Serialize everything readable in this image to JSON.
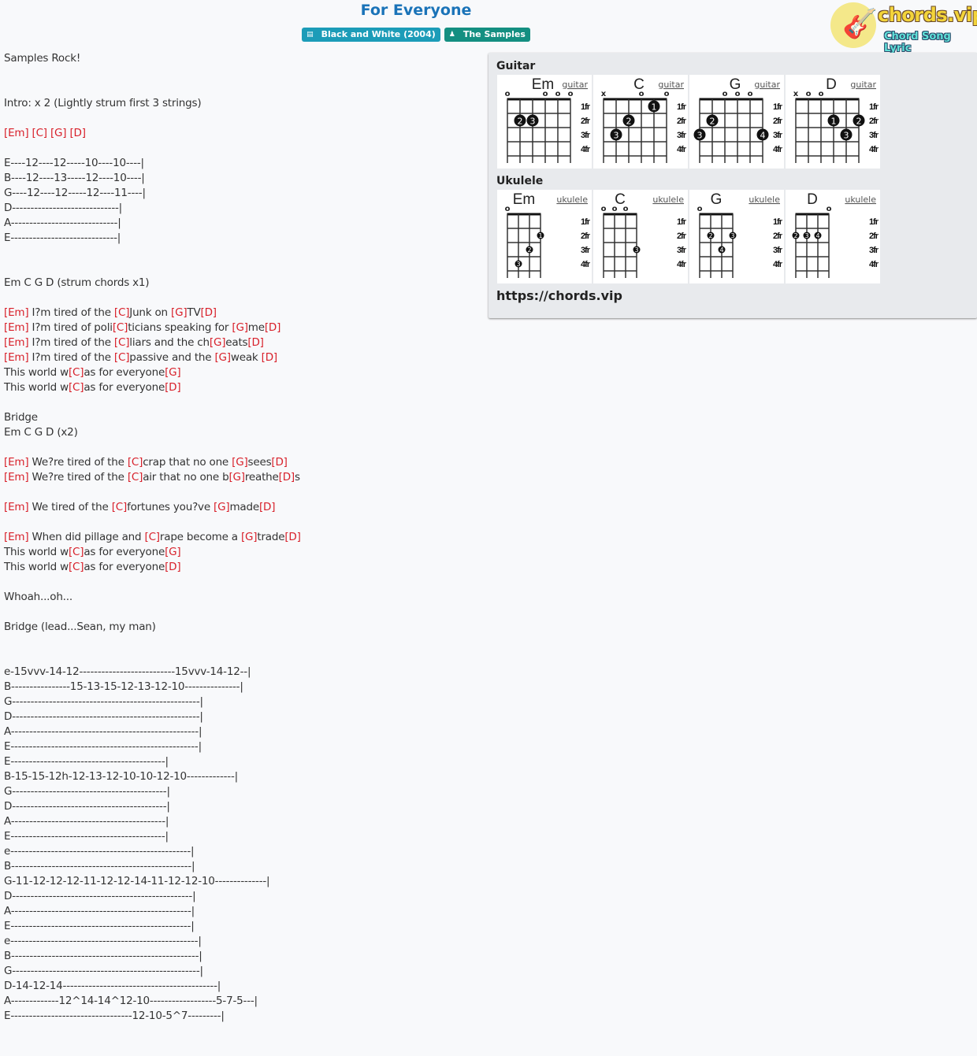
{
  "header": {
    "title": "For Everyone",
    "album_badge": "Black and White (2004)",
    "album_icon": "book-icon",
    "artist_badge": "The Samples",
    "artist_icon": "user-icon"
  },
  "logo": {
    "name": "chords.vip",
    "tagline": "Chord Song Lyric"
  },
  "lyrics": [
    [
      [
        "t",
        "Samples Rock!"
      ]
    ],
    [],
    [],
    [
      [
        "t",
        "Intro: x 2 (Lightly strum first 3 strings)"
      ]
    ],
    [],
    [
      [
        "c",
        "[Em]"
      ],
      [
        "t",
        " "
      ],
      [
        "c",
        "[C]"
      ],
      [
        "t",
        " "
      ],
      [
        "c",
        "[G]"
      ],
      [
        "t",
        " "
      ],
      [
        "c",
        "[D]"
      ]
    ],
    [],
    [
      [
        "t",
        "E----12----12-----10----10----|"
      ]
    ],
    [
      [
        "t",
        "B----12----13-----12----10----|"
      ]
    ],
    [
      [
        "t",
        "G----12----12-----12----11----|"
      ]
    ],
    [
      [
        "t",
        "D-----------------------------|"
      ]
    ],
    [
      [
        "t",
        "A-----------------------------|"
      ]
    ],
    [
      [
        "t",
        "E-----------------------------|"
      ]
    ],
    [],
    [],
    [
      [
        "t",
        "Em C G D (strum chords x1)"
      ]
    ],
    [],
    [
      [
        "c",
        "[Em]"
      ],
      [
        "t",
        " I?m tired of the "
      ],
      [
        "c",
        "[C]"
      ],
      [
        "t",
        "Junk on "
      ],
      [
        "c",
        "[G]"
      ],
      [
        "t",
        "TV"
      ],
      [
        "c",
        "[D]"
      ]
    ],
    [
      [
        "c",
        "[Em]"
      ],
      [
        "t",
        " I?m tired of poli"
      ],
      [
        "c",
        "[C]"
      ],
      [
        "t",
        "ticians speaking for "
      ],
      [
        "c",
        "[G]"
      ],
      [
        "t",
        "me"
      ],
      [
        "c",
        "[D]"
      ]
    ],
    [
      [
        "c",
        "[Em]"
      ],
      [
        "t",
        " I?m tired of the "
      ],
      [
        "c",
        "[C]"
      ],
      [
        "t",
        "liars and the ch"
      ],
      [
        "c",
        "[G]"
      ],
      [
        "t",
        "eats"
      ],
      [
        "c",
        "[D]"
      ]
    ],
    [
      [
        "c",
        "[Em]"
      ],
      [
        "t",
        " I?m tired of the "
      ],
      [
        "c",
        "[C]"
      ],
      [
        "t",
        "passive and the "
      ],
      [
        "c",
        "[G]"
      ],
      [
        "t",
        "weak "
      ],
      [
        "c",
        "[D]"
      ]
    ],
    [
      [
        "t",
        "This world w"
      ],
      [
        "c",
        "[C]"
      ],
      [
        "t",
        "as for everyone"
      ],
      [
        "c",
        "[G]"
      ]
    ],
    [
      [
        "t",
        "This world w"
      ],
      [
        "c",
        "[C]"
      ],
      [
        "t",
        "as for everyone"
      ],
      [
        "c",
        "[D]"
      ]
    ],
    [],
    [
      [
        "t",
        "Bridge"
      ]
    ],
    [
      [
        "t",
        "Em C G D (x2)"
      ]
    ],
    [],
    [
      [
        "c",
        "[Em]"
      ],
      [
        "t",
        " We?re tired of the "
      ],
      [
        "c",
        "[C]"
      ],
      [
        "t",
        "crap that no one "
      ],
      [
        "c",
        "[G]"
      ],
      [
        "t",
        "sees"
      ],
      [
        "c",
        "[D]"
      ]
    ],
    [
      [
        "c",
        "[Em]"
      ],
      [
        "t",
        " We?re tired of the "
      ],
      [
        "c",
        "[C]"
      ],
      [
        "t",
        "air that no one b"
      ],
      [
        "c",
        "[G]"
      ],
      [
        "t",
        "reathe"
      ],
      [
        "c",
        "[D]"
      ],
      [
        "t",
        "s"
      ]
    ],
    [],
    [
      [
        "c",
        "[Em]"
      ],
      [
        "t",
        " We tired of the "
      ],
      [
        "c",
        "[C]"
      ],
      [
        "t",
        "fortunes you?ve "
      ],
      [
        "c",
        "[G]"
      ],
      [
        "t",
        "made"
      ],
      [
        "c",
        "[D]"
      ]
    ],
    [],
    [
      [
        "c",
        "[Em]"
      ],
      [
        "t",
        " When did pillage and "
      ],
      [
        "c",
        "[C]"
      ],
      [
        "t",
        "rape become a "
      ],
      [
        "c",
        "[G]"
      ],
      [
        "t",
        "trade"
      ],
      [
        "c",
        "[D]"
      ]
    ],
    [
      [
        "t",
        "This world w"
      ],
      [
        "c",
        "[C]"
      ],
      [
        "t",
        "as for everyone"
      ],
      [
        "c",
        "[G]"
      ]
    ],
    [
      [
        "t",
        "This world w"
      ],
      [
        "c",
        "[C]"
      ],
      [
        "t",
        "as for everyone"
      ],
      [
        "c",
        "[D]"
      ]
    ],
    [],
    [
      [
        "t",
        "Whoah...oh..."
      ]
    ],
    [],
    [
      [
        "t",
        "Bridge (lead...Sean, my man)"
      ]
    ],
    [],
    [],
    [
      [
        "t",
        "e-15vvv-14-12--------------------------15vvv-14-12--|"
      ]
    ],
    [
      [
        "t",
        "B----------------15-13-15-12-13-12-10---------------|"
      ]
    ],
    [
      [
        "t",
        "G---------------------------------------------------|"
      ]
    ],
    [
      [
        "t",
        "D---------------------------------------------------|"
      ]
    ],
    [
      [
        "t",
        "A---------------------------------------------------|"
      ]
    ],
    [
      [
        "t",
        "E---------------------------------------------------|"
      ]
    ],
    [
      [
        "t",
        "E------------------------------------------|"
      ]
    ],
    [
      [
        "t",
        "B-15-15-12h-12-13-12-10-10-12-10-------------|"
      ]
    ],
    [
      [
        "t",
        "G------------------------------------------|"
      ]
    ],
    [
      [
        "t",
        "D------------------------------------------|"
      ]
    ],
    [
      [
        "t",
        "A------------------------------------------|"
      ]
    ],
    [
      [
        "t",
        "E------------------------------------------|"
      ]
    ],
    [
      [
        "t",
        "e-------------------------------------------------|"
      ]
    ],
    [
      [
        "t",
        "B-------------------------------------------------|"
      ]
    ],
    [
      [
        "t",
        "G-11-12-12-12-11-12-12-14-11-12-12-10--------------|"
      ]
    ],
    [
      [
        "t",
        "D-------------------------------------------------|"
      ]
    ],
    [
      [
        "t",
        "A-------------------------------------------------|"
      ]
    ],
    [
      [
        "t",
        "E-------------------------------------------------|"
      ]
    ],
    [
      [
        "t",
        "e---------------------------------------------------|"
      ]
    ],
    [
      [
        "t",
        "B---------------------------------------------------|"
      ]
    ],
    [
      [
        "t",
        "G---------------------------------------------------|"
      ]
    ],
    [
      [
        "t",
        "D-14-12-14------------------------------------------|"
      ]
    ],
    [
      [
        "t",
        "A-------------12^14-14^12-10------------------5-7-5---|"
      ]
    ],
    [
      [
        "t",
        "E---------------------------------12-10-5^7---------|"
      ]
    ]
  ],
  "chord_panel": {
    "guitar_heading": "Guitar",
    "ukulele_heading": "Ukulele",
    "fret_labels": [
      "1fr",
      "2fr",
      "3fr",
      "4fr"
    ],
    "guitar": [
      {
        "name": "Em",
        "link": "guitar",
        "markers": [
          "o",
          "",
          "",
          "o",
          "o",
          "o"
        ],
        "dots": [
          {
            "string": 2,
            "fret": 2,
            "finger": "2"
          },
          {
            "string": 3,
            "fret": 2,
            "finger": "3"
          }
        ]
      },
      {
        "name": "C",
        "link": "guitar",
        "markers": [
          "x",
          "",
          "",
          "o",
          "",
          "o"
        ],
        "dots": [
          {
            "string": 5,
            "fret": 1,
            "finger": "1"
          },
          {
            "string": 3,
            "fret": 2,
            "finger": "2"
          },
          {
            "string": 2,
            "fret": 3,
            "finger": "3"
          }
        ]
      },
      {
        "name": "G",
        "link": "guitar",
        "markers": [
          "",
          "",
          "o",
          "o",
          "o",
          ""
        ],
        "dots": [
          {
            "string": 2,
            "fret": 2,
            "finger": "2"
          },
          {
            "string": 1,
            "fret": 3,
            "finger": "3"
          },
          {
            "string": 6,
            "fret": 3,
            "finger": "4"
          }
        ]
      },
      {
        "name": "D",
        "link": "guitar",
        "markers": [
          "x",
          "o",
          "o",
          "",
          "",
          ""
        ],
        "dots": [
          {
            "string": 4,
            "fret": 2,
            "finger": "1"
          },
          {
            "string": 6,
            "fret": 2,
            "finger": "2"
          },
          {
            "string": 5,
            "fret": 3,
            "finger": "3"
          }
        ]
      }
    ],
    "ukulele": [
      {
        "name": "Em",
        "link": "ukulele",
        "markers": [
          "o",
          "",
          "",
          ""
        ],
        "dots": [
          {
            "string": 4,
            "fret": 2,
            "finger": "1"
          },
          {
            "string": 3,
            "fret": 3,
            "finger": "2"
          },
          {
            "string": 2,
            "fret": 4,
            "finger": "3"
          }
        ]
      },
      {
        "name": "C",
        "link": "ukulele",
        "markers": [
          "o",
          "o",
          "o",
          ""
        ],
        "dots": [
          {
            "string": 4,
            "fret": 3,
            "finger": "3"
          }
        ]
      },
      {
        "name": "G",
        "link": "ukulele",
        "markers": [
          "o",
          "",
          "",
          ""
        ],
        "dots": [
          {
            "string": 2,
            "fret": 2,
            "finger": "2"
          },
          {
            "string": 4,
            "fret": 2,
            "finger": "3"
          },
          {
            "string": 3,
            "fret": 3,
            "finger": "4"
          }
        ]
      },
      {
        "name": "D",
        "link": "ukulele",
        "markers": [
          "",
          "",
          "",
          "o"
        ],
        "dots": [
          {
            "string": 1,
            "fret": 2,
            "finger": "2"
          },
          {
            "string": 2,
            "fret": 2,
            "finger": "3"
          },
          {
            "string": 3,
            "fret": 2,
            "finger": "4"
          }
        ]
      }
    ],
    "url": "https://chords.vip"
  },
  "colors": {
    "title": "#1a73b8",
    "chord": "#d8202a",
    "album_badge": "#1c9cb8",
    "artist_badge": "#148f81"
  }
}
